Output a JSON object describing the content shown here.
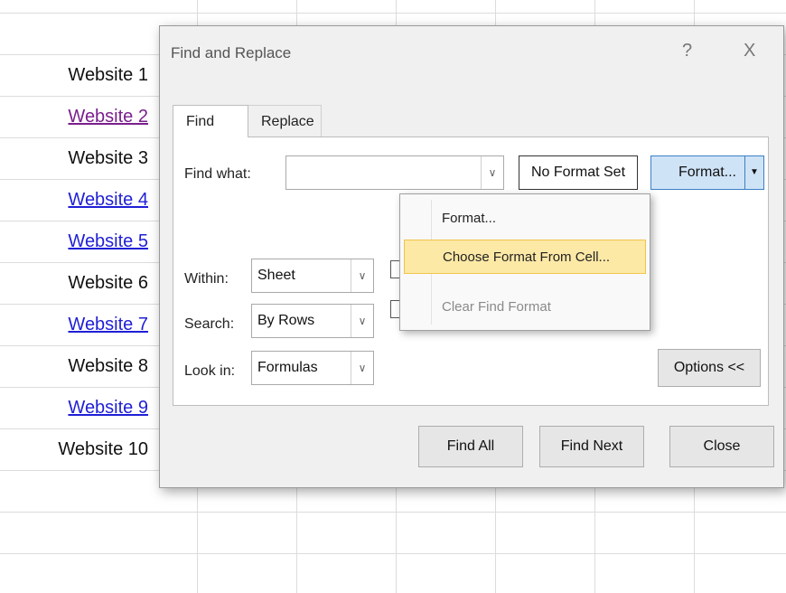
{
  "sheet": {
    "cells": [
      {
        "text": "Website 1",
        "style": "plain"
      },
      {
        "text": "Website 2",
        "style": "visited"
      },
      {
        "text": "Website 3",
        "style": "plain"
      },
      {
        "text": "Website 4",
        "style": "link"
      },
      {
        "text": "Website 5",
        "style": "link"
      },
      {
        "text": "Website 6",
        "style": "plain"
      },
      {
        "text": "Website 7",
        "style": "link"
      },
      {
        "text": "Website 8",
        "style": "plain"
      },
      {
        "text": "Website 9",
        "style": "link"
      },
      {
        "text": "Website 10",
        "style": "plain"
      }
    ]
  },
  "dialog": {
    "title": "Find and Replace",
    "help_glyph": "?",
    "close_glyph": "X",
    "tabs": [
      {
        "label": "Find",
        "active": true
      },
      {
        "label": "Replace",
        "active": false
      }
    ],
    "find_what_label": "Find what:",
    "find_what_value": "",
    "format_status": "No Format Set",
    "format_button": "Format...",
    "within_label": "Within:",
    "within_value": "Sheet",
    "search_label": "Search:",
    "search_value": "By Rows",
    "lookin_label": "Look in:",
    "lookin_value": "Formulas",
    "options_button": "Options <<",
    "find_all_button": "Find All",
    "find_next_button": "Find Next",
    "close_button": "Close"
  },
  "format_menu": {
    "items": [
      {
        "label": "Format...",
        "state": "normal"
      },
      {
        "label": "Choose Format From Cell...",
        "state": "highlighted"
      },
      {
        "label": "Clear Find Format",
        "state": "disabled"
      }
    ]
  },
  "colors": {
    "link": "#1f1fd6",
    "visited": "#7a1f8c",
    "highlight": "#fde9a6",
    "format_button_bg": "#cfe3f7"
  }
}
